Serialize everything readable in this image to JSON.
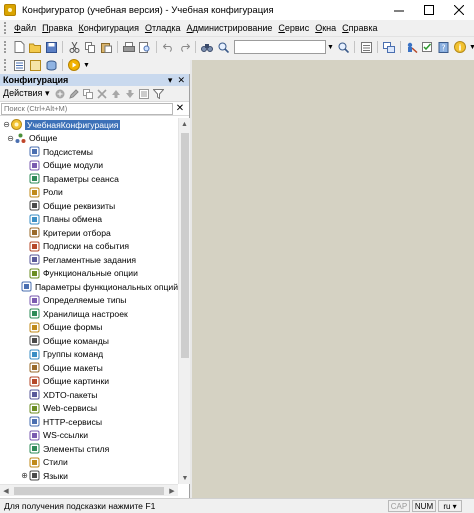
{
  "window": {
    "title": "Конфигуратор (учебная версия) - Учебная конфигурация"
  },
  "menu": [
    "Файл",
    "Правка",
    "Конфигурация",
    "Отладка",
    "Администрирование",
    "Сервис",
    "Окна",
    "Справка"
  ],
  "toolbar": {
    "search_value": ""
  },
  "panel": {
    "title": "Конфигурация",
    "actions_label": "Действия",
    "search_placeholder": "Поиск (Ctrl+Alt+M)"
  },
  "tree": {
    "root": {
      "label": "УчебнаяКонфигурация",
      "icon": "config-root-icon"
    },
    "common": {
      "label": "Общие",
      "icon": "common-group-icon"
    },
    "items": [
      {
        "label": "Подсистемы",
        "icon": "subsystems-icon"
      },
      {
        "label": "Общие модули",
        "icon": "common-modules-icon"
      },
      {
        "label": "Параметры сеанса",
        "icon": "session-params-icon"
      },
      {
        "label": "Роли",
        "icon": "roles-icon"
      },
      {
        "label": "Общие реквизиты",
        "icon": "common-attributes-icon"
      },
      {
        "label": "Планы обмена",
        "icon": "exchange-plans-icon"
      },
      {
        "label": "Критерии отбора",
        "icon": "filter-criteria-icon"
      },
      {
        "label": "Подписки на события",
        "icon": "event-subscriptions-icon"
      },
      {
        "label": "Регламентные задания",
        "icon": "scheduled-jobs-icon"
      },
      {
        "label": "Функциональные опции",
        "icon": "functional-options-icon"
      },
      {
        "label": "Параметры функциональных опций",
        "icon": "functional-option-params-icon"
      },
      {
        "label": "Определяемые типы",
        "icon": "defined-types-icon"
      },
      {
        "label": "Хранилища настроек",
        "icon": "settings-storages-icon"
      },
      {
        "label": "Общие формы",
        "icon": "common-forms-icon"
      },
      {
        "label": "Общие команды",
        "icon": "common-commands-icon"
      },
      {
        "label": "Группы команд",
        "icon": "command-groups-icon"
      },
      {
        "label": "Общие макеты",
        "icon": "common-templates-icon"
      },
      {
        "label": "Общие картинки",
        "icon": "common-pictures-icon"
      },
      {
        "label": "XDTO-пакеты",
        "icon": "xdto-packages-icon"
      },
      {
        "label": "Web-сервисы",
        "icon": "web-services-icon"
      },
      {
        "label": "HTTP-сервисы",
        "icon": "http-services-icon"
      },
      {
        "label": "WS-ссылки",
        "icon": "ws-references-icon"
      },
      {
        "label": "Элементы стиля",
        "icon": "style-items-icon"
      },
      {
        "label": "Стили",
        "icon": "styles-icon"
      },
      {
        "label": "Языки",
        "icon": "languages-icon"
      }
    ]
  },
  "status": {
    "hint": "Для получения подсказки нажмите F1",
    "cap": "CAP",
    "num": "NUM",
    "lang": "ru"
  },
  "colors": {
    "selection": "#3d71b8",
    "panel_header": "#c9d9ee",
    "mdi_background": "#d5d2c3"
  }
}
